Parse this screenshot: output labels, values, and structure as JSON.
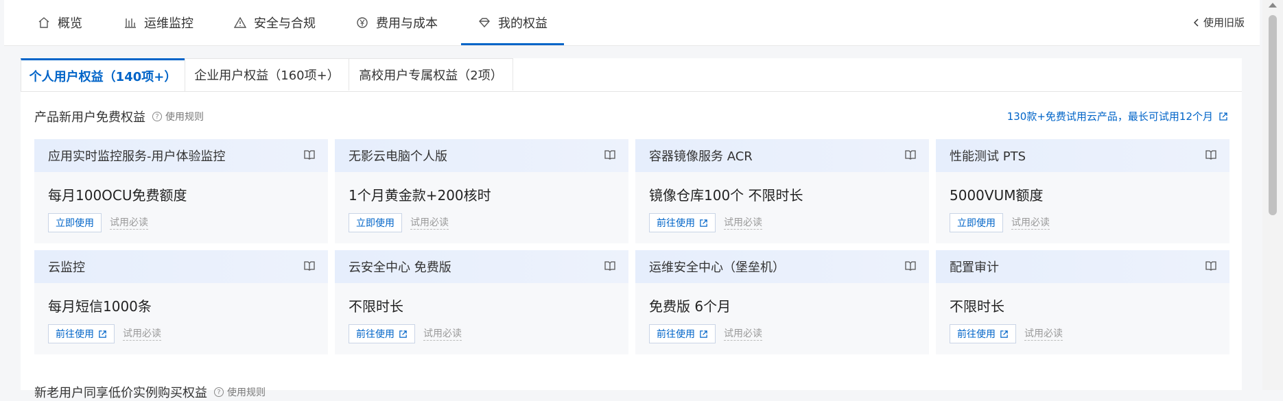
{
  "nav": {
    "tabs": [
      {
        "label": "概览",
        "icon": "home-icon"
      },
      {
        "label": "运维监控",
        "icon": "bar-chart-icon"
      },
      {
        "label": "安全与合规",
        "icon": "warning-icon"
      },
      {
        "label": "费用与成本",
        "icon": "yen-circle-icon"
      },
      {
        "label": "我的权益",
        "icon": "diamond-icon"
      }
    ],
    "active_tab": "我的权益",
    "old_version_label": "使用旧版"
  },
  "subtabs": [
    {
      "label": "个人用户权益（140项+）",
      "active": true
    },
    {
      "label": "企业用户权益（160项+）",
      "active": false
    },
    {
      "label": "高校用户专属权益（2项）",
      "active": false
    }
  ],
  "section": {
    "title": "产品新用户免费权益",
    "rules_label": "使用规则",
    "promo_link": "130款+免费试用云产品，最长可试用12个月"
  },
  "cards": [
    {
      "title": "应用实时监控服务-用户体验监控",
      "benefit": "每月100OCU免费额度",
      "button": "立即使用",
      "external": false,
      "read": "试用必读"
    },
    {
      "title": "无影云电脑个人版",
      "benefit": "1个月黄金款+200核时",
      "button": "立即使用",
      "external": false,
      "read": "试用必读"
    },
    {
      "title": "容器镜像服务 ACR",
      "benefit": "镜像仓库100个 不限时长",
      "button": "前往使用",
      "external": true,
      "read": "试用必读"
    },
    {
      "title": "性能测试 PTS",
      "benefit": "5000VUM额度",
      "button": "立即使用",
      "external": false,
      "read": "试用必读"
    },
    {
      "title": "云监控",
      "benefit": "每月短信1000条",
      "button": "前往使用",
      "external": true,
      "read": "试用必读"
    },
    {
      "title": "云安全中心 免费版",
      "benefit": "不限时长",
      "button": "前往使用",
      "external": true,
      "read": "试用必读"
    },
    {
      "title": "运维安全中心（堡垒机）",
      "benefit": "免费版 6个月",
      "button": "前往使用",
      "external": true,
      "read": "试用必读"
    },
    {
      "title": "配置审计",
      "benefit": "不限时长",
      "button": "前往使用",
      "external": true,
      "read": "试用必读"
    }
  ],
  "next_section": {
    "title": "新老用户同享低价实例购买权益",
    "rules_label": "使用规则"
  },
  "colors": {
    "accent": "#0064c8",
    "card_header": "#e6eefc",
    "card_body": "#f7f8fa",
    "page_bg": "#f5f6f8"
  }
}
